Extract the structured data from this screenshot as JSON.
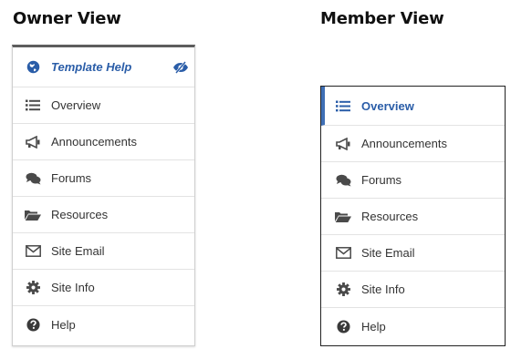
{
  "owner_view": {
    "title": "Owner View",
    "header": {
      "label": "Template Help",
      "icon": "globe-icon",
      "toggle_icon": "eye-slash-icon"
    },
    "items": [
      {
        "label": "Overview",
        "icon": "list-icon"
      },
      {
        "label": "Announcements",
        "icon": "megaphone-icon"
      },
      {
        "label": "Forums",
        "icon": "comments-icon"
      },
      {
        "label": "Resources",
        "icon": "folder-open-icon"
      },
      {
        "label": "Site Email",
        "icon": "envelope-icon"
      },
      {
        "label": "Site Info",
        "icon": "gear-icon"
      },
      {
        "label": "Help",
        "icon": "question-circle-icon"
      }
    ]
  },
  "member_view": {
    "title": "Member View",
    "items": [
      {
        "label": "Overview",
        "icon": "list-icon",
        "active": true
      },
      {
        "label": "Announcements",
        "icon": "megaphone-icon"
      },
      {
        "label": "Forums",
        "icon": "comments-icon"
      },
      {
        "label": "Resources",
        "icon": "folder-open-icon"
      },
      {
        "label": "Site Email",
        "icon": "envelope-icon"
      },
      {
        "label": "Site Info",
        "icon": "gear-icon"
      },
      {
        "label": "Help",
        "icon": "question-circle-icon"
      }
    ]
  },
  "colors": {
    "accent": "#2a5da8",
    "active_bar": "#3f6fb5",
    "icon": "#4a4a4a"
  }
}
